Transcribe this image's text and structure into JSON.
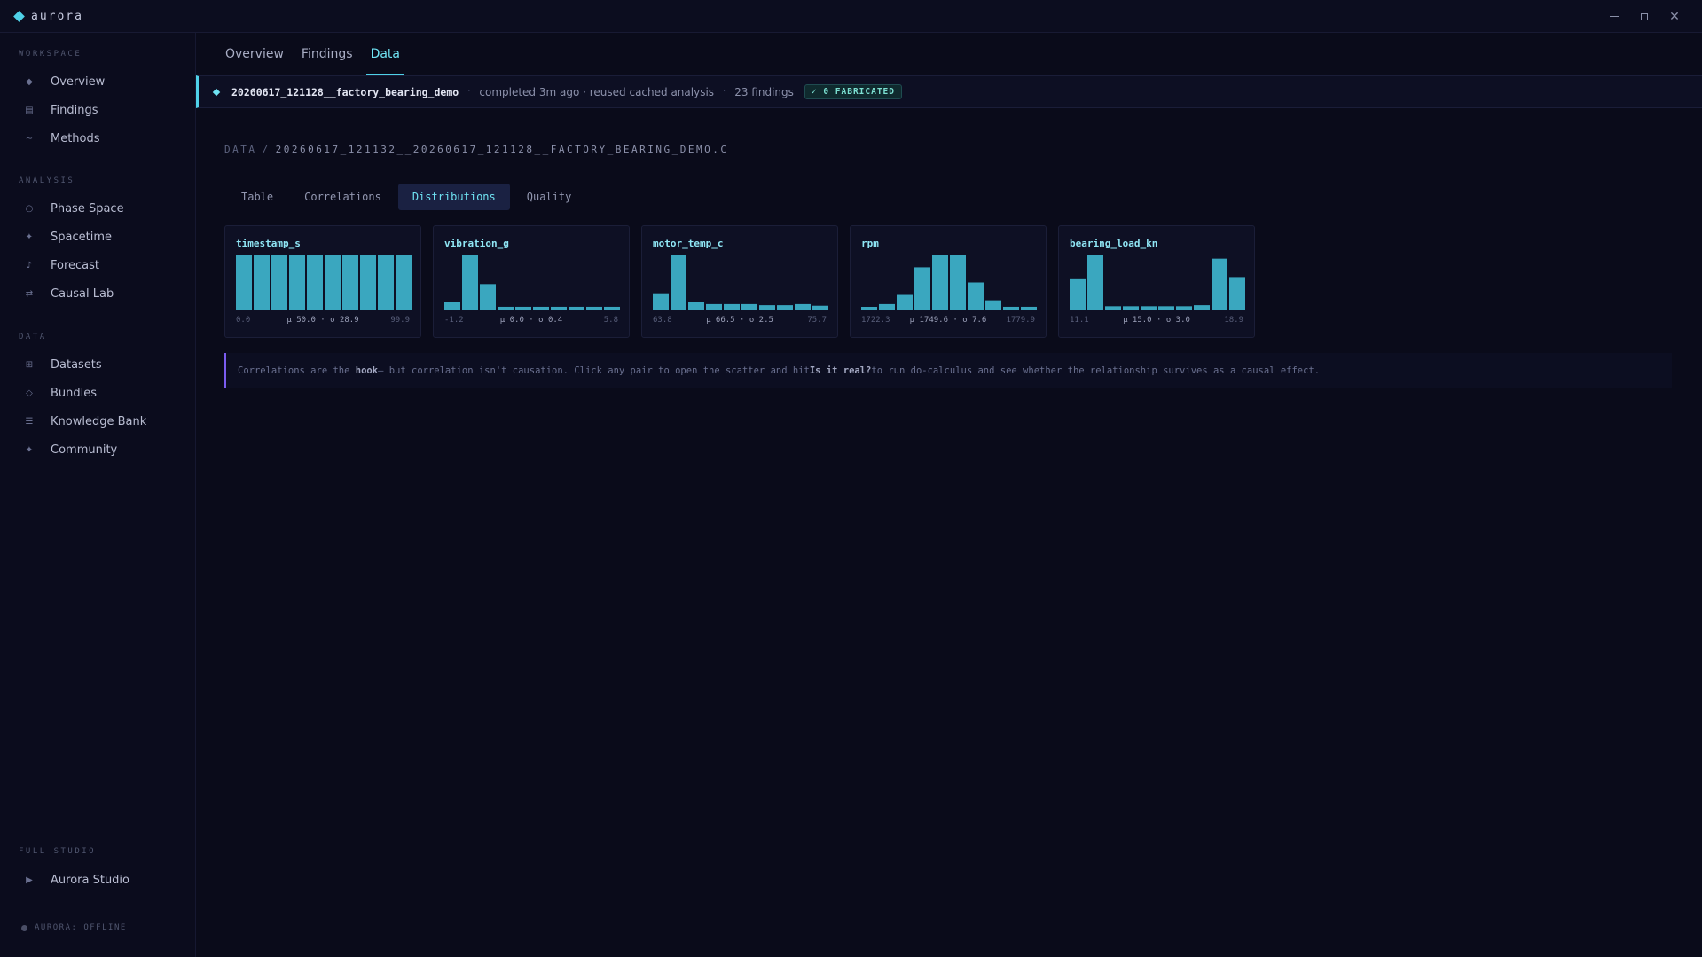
{
  "app": {
    "name": "aurora"
  },
  "sidebar": {
    "sections": [
      {
        "label": "WORKSPACE",
        "items": [
          {
            "label": "Overview",
            "icon": "diamond-icon"
          },
          {
            "label": "Findings",
            "icon": "list-icon"
          },
          {
            "label": "Methods",
            "icon": "wave-icon"
          }
        ]
      },
      {
        "label": "ANALYSIS",
        "items": [
          {
            "label": "Phase Space",
            "icon": "circle-icon"
          },
          {
            "label": "Spacetime",
            "icon": "sparkle-icon"
          },
          {
            "label": "Forecast",
            "icon": "forecast-icon"
          },
          {
            "label": "Causal Lab",
            "icon": "arrows-icon"
          }
        ]
      },
      {
        "label": "DATA",
        "items": [
          {
            "label": "Datasets",
            "icon": "grid-icon"
          },
          {
            "label": "Bundles",
            "icon": "diamond-outline-icon"
          },
          {
            "label": "Knowledge Bank",
            "icon": "lines-icon"
          },
          {
            "label": "Community",
            "icon": "star-icon"
          }
        ]
      },
      {
        "label": "FULL STUDIO",
        "items": [
          {
            "label": "Aurora Studio",
            "icon": "play-icon"
          }
        ]
      }
    ],
    "status": "AURORA: OFFLINE"
  },
  "top_tabs": [
    {
      "label": "Overview",
      "active": false
    },
    {
      "label": "Findings",
      "active": false
    },
    {
      "label": "Data",
      "active": true
    }
  ],
  "run": {
    "id": "20260617_121128__factory_bearing_demo",
    "status": "completed 3m ago · reused cached analysis",
    "findings": "23 findings",
    "badge": "✓ 0 FABRICATED"
  },
  "breadcrumb": {
    "root": "DATA",
    "separator": "/",
    "current": "20260617_121132__20260617_121128__FACTORY_BEARING_DEMO.C"
  },
  "sub_tabs": [
    {
      "label": "Table",
      "active": false
    },
    {
      "label": "Correlations",
      "active": false
    },
    {
      "label": "Distributions",
      "active": true
    },
    {
      "label": "Quality",
      "active": false
    }
  ],
  "distributions": [
    {
      "name": "timestamp_s",
      "min": "0.0",
      "max": "99.9",
      "stats": "μ 50.0 · σ 28.9",
      "bins": [
        1,
        1,
        1,
        1,
        1,
        1,
        1,
        1,
        1,
        1
      ]
    },
    {
      "name": "vibration_g",
      "min": "-1.2",
      "max": "5.8",
      "stats": "μ 0.0 · σ 0.4",
      "bins": [
        0.14,
        1,
        0.47,
        0.05,
        0.05,
        0.05,
        0.05,
        0.05,
        0.05,
        0.05
      ]
    },
    {
      "name": "motor_temp_c",
      "min": "63.8",
      "max": "75.7",
      "stats": "μ 66.5 · σ 2.5",
      "bins": [
        0.3,
        1,
        0.14,
        0.1,
        0.1,
        0.1,
        0.08,
        0.08,
        0.1,
        0.07
      ]
    },
    {
      "name": "rpm",
      "min": "1722.3",
      "max": "1779.9",
      "stats": "μ 1749.6 · σ 7.6",
      "bins": [
        0.04,
        0.1,
        0.27,
        0.78,
        1,
        1,
        0.5,
        0.17,
        0.05,
        0.05
      ]
    },
    {
      "name": "bearing_load_kn",
      "min": "11.1",
      "max": "18.9",
      "stats": "μ 15.0 · σ 3.0",
      "bins": [
        0.56,
        1,
        0.06,
        0.06,
        0.06,
        0.06,
        0.06,
        0.08,
        0.94,
        0.6
      ]
    }
  ],
  "hint": {
    "part1": "Correlations are the ",
    "bold1": "hook",
    "part2": " — but correlation isn't causation. Click any pair to open the scatter and hit ",
    "bold2": "Is it real?",
    "part3": " to run do-calculus and see whether the relationship survives as a causal effect."
  },
  "colors": {
    "accent": "#4fd1e8",
    "bar": "#3aa7bf",
    "hint_border": "#7b5cf0",
    "badge_text": "#7ce0d2"
  }
}
